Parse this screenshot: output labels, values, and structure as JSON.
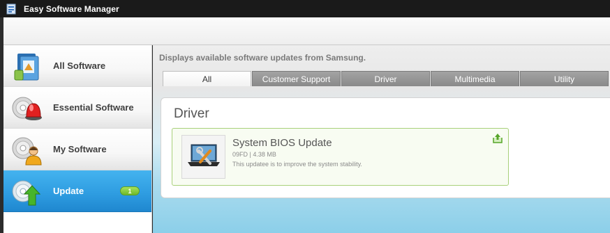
{
  "window": {
    "title": "Easy Software Manager",
    "icon": "app-icon"
  },
  "sidebar": {
    "items": [
      {
        "label": "All Software",
        "icon": "all-software-icon",
        "active": false
      },
      {
        "label": "Essential Software",
        "icon": "essential-software-icon",
        "active": false
      },
      {
        "label": "My Software",
        "icon": "my-software-icon",
        "active": false
      },
      {
        "label": "Update",
        "icon": "update-icon",
        "active": true,
        "badge": "1"
      }
    ]
  },
  "main": {
    "description": "Displays available software updates from Samsung.",
    "tabs": [
      {
        "label": "All",
        "active": true
      },
      {
        "label": "Customer Support",
        "active": false
      },
      {
        "label": "Driver",
        "active": false
      },
      {
        "label": "Multimedia",
        "active": false
      },
      {
        "label": "Utility",
        "active": false
      }
    ],
    "section_title": "Driver",
    "items": [
      {
        "title": "System BIOS Update",
        "meta": "09FD | 4.38 MB",
        "description": "This updatee is to improve the system stability.",
        "thumb_icon": "laptop-tools-icon",
        "action_icon": "install-update-icon"
      }
    ]
  },
  "colors": {
    "accent_blue": "#2d9be0",
    "badge_green": "#6fb92a",
    "item_border_green": "#a8d07a"
  }
}
